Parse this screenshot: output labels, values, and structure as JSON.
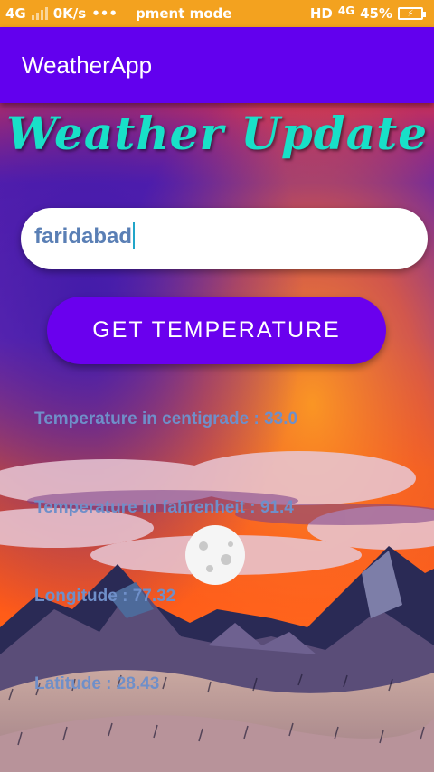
{
  "status_bar": {
    "network": "4G",
    "speed": "0K/s",
    "dots": "•••",
    "notification": "pment mode",
    "hd": "HD",
    "network2": "4G",
    "battery_percent": "45%"
  },
  "app_bar": {
    "title": "WeatherApp"
  },
  "headline": "Weather Update",
  "search": {
    "value": "faridabad"
  },
  "button": {
    "label": "GET TEMPERATURE"
  },
  "results": {
    "centigrade": "Temperature in centigrade : 33.0",
    "fahrenheit": "Temperature in fahrenheit : 91.4",
    "longitude": "Longitude : 77.32",
    "latitude": "Latitude : 28.43"
  },
  "colors": {
    "status_bar": "#f3a21f",
    "app_bar": "#6200ee",
    "button": "#6a00ee",
    "headline": "#18e0c8",
    "info_text": "#6f8fc9"
  }
}
